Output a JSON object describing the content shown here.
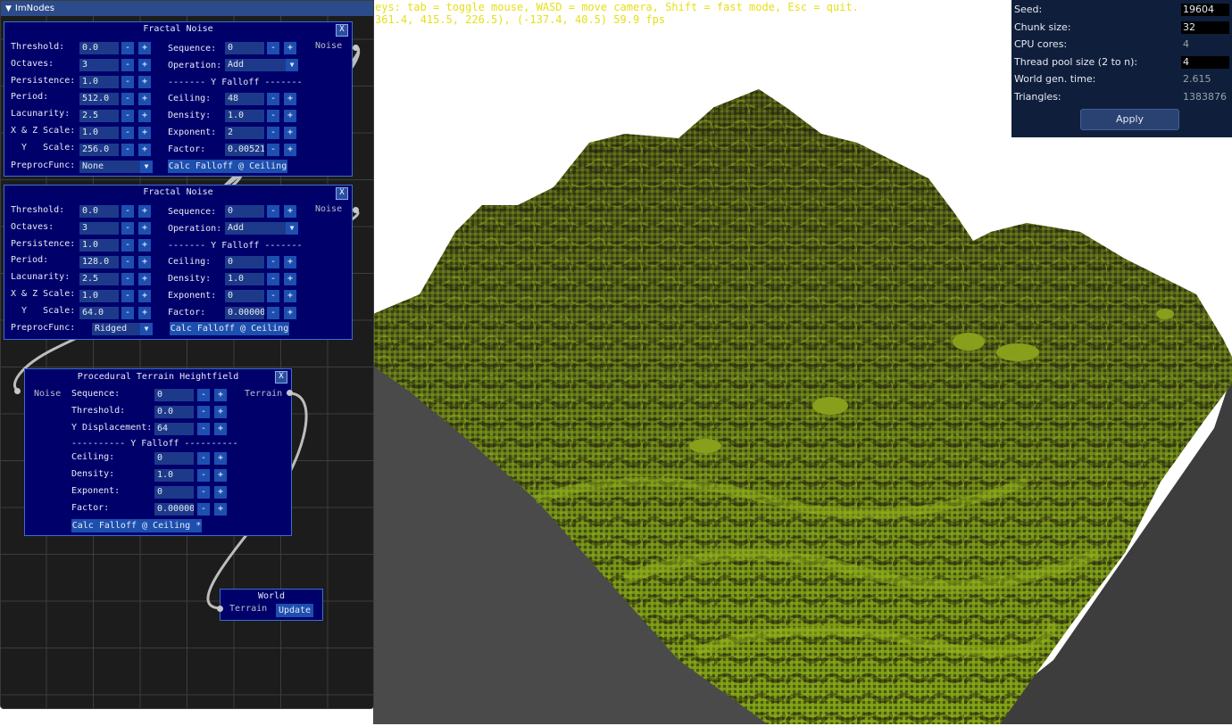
{
  "hud": {
    "line1": "eys: tab = toggle mouse, WASD = move camera, Shift = fast mode, Esc = quit.",
    "line2": "361.4, 415.5, 226.5), (-137.4, 40.5) 59.9 fps"
  },
  "imnodes": {
    "title": "ImNodes",
    "collapse_icon": "triangle-down-icon",
    "fractal1": {
      "title": "Fractal Noise",
      "close": "X",
      "output_label": "Noise",
      "rows_left": [
        {
          "label": "Threshold:",
          "value": "0.0"
        },
        {
          "label": "Octaves:",
          "value": "3"
        },
        {
          "label": "Persistence:",
          "value": "1.0"
        },
        {
          "label": "Period:",
          "value": "512.0"
        },
        {
          "label": "Lacunarity:",
          "value": "2.5"
        },
        {
          "label": "X & Z Scale:",
          "value": "1.0"
        },
        {
          "label": "  Y   Scale:",
          "value": "256.0"
        }
      ],
      "preproc_label": "PreprocFunc:",
      "preproc_value": "None",
      "seq_label": "Sequence:",
      "seq_value": "0",
      "op_label": "Operation:",
      "op_value": "Add",
      "falloff_header": "------- Y Falloff -------",
      "rows_right": [
        {
          "label": "Ceiling:",
          "value": "48"
        },
        {
          "label": "Density:",
          "value": "1.0"
        },
        {
          "label": "Exponent:",
          "value": "2"
        },
        {
          "label": "Factor:",
          "value": "0.00521"
        }
      ],
      "calc_button": "Calc Falloff @ Ceiling"
    },
    "fractal2": {
      "title": "Fractal Noise",
      "close": "X",
      "output_label": "Noise",
      "rows_left": [
        {
          "label": "Threshold:",
          "value": "0.0"
        },
        {
          "label": "Octaves:",
          "value": "3"
        },
        {
          "label": "Persistence:",
          "value": "1.0"
        },
        {
          "label": "Period:",
          "value": "128.0"
        },
        {
          "label": "Lacunarity:",
          "value": "2.5"
        },
        {
          "label": "X & Z Scale:",
          "value": "1.0"
        },
        {
          "label": "  Y   Scale:",
          "value": "64.0"
        }
      ],
      "preproc_label": "PreprocFunc:",
      "preproc_value": "Ridged",
      "seq_label": "Sequence:",
      "seq_value": "0",
      "op_label": "Operation:",
      "op_value": "Add",
      "falloff_header": "------- Y Falloff -------",
      "rows_right": [
        {
          "label": "Ceiling:",
          "value": "0"
        },
        {
          "label": "Density:",
          "value": "1.0"
        },
        {
          "label": "Exponent:",
          "value": "0"
        },
        {
          "label": "Factor:",
          "value": "0.00000"
        }
      ],
      "calc_button": "Calc Falloff @ Ceiling"
    },
    "terrain": {
      "title": "Procedural Terrain Heightfield",
      "close": "X",
      "input_label": "Noise",
      "output_label": "Terrain",
      "rows": [
        {
          "label": "Sequence:",
          "value": "0"
        },
        {
          "label": "Threshold:",
          "value": "0.0"
        },
        {
          "label": "Y Displacement:",
          "value": "64"
        }
      ],
      "falloff_header": "---------- Y Falloff ----------",
      "falloff_rows": [
        {
          "label": "Ceiling:",
          "value": "0"
        },
        {
          "label": "Density:",
          "value": "1.0"
        },
        {
          "label": "Exponent:",
          "value": "0"
        },
        {
          "label": "Factor:",
          "value": "0.00000"
        }
      ],
      "calc_button": "Calc Falloff @ Ceiling *"
    },
    "world": {
      "title": "World",
      "input_label": "Terrain",
      "update_button": "Update"
    },
    "minus": "-",
    "plus": "+"
  },
  "settings": {
    "seed_label": "Seed:",
    "seed_value": "19604",
    "chunk_label": "Chunk size:",
    "chunk_value": "32",
    "cpu_label": "CPU cores:",
    "cpu_value": "4",
    "pool_label": "Thread pool size (2 to n):",
    "pool_value": "4",
    "gen_label": "World gen. time:",
    "gen_value": "2.615",
    "tri_label": "Triangles:",
    "tri_value": "1383876",
    "apply_label": "Apply"
  },
  "colors": {
    "node_bg": "#00006b",
    "grass": "#8aa616",
    "terrain_dark": "#2f2f12",
    "hud_text": "#e6df17"
  }
}
